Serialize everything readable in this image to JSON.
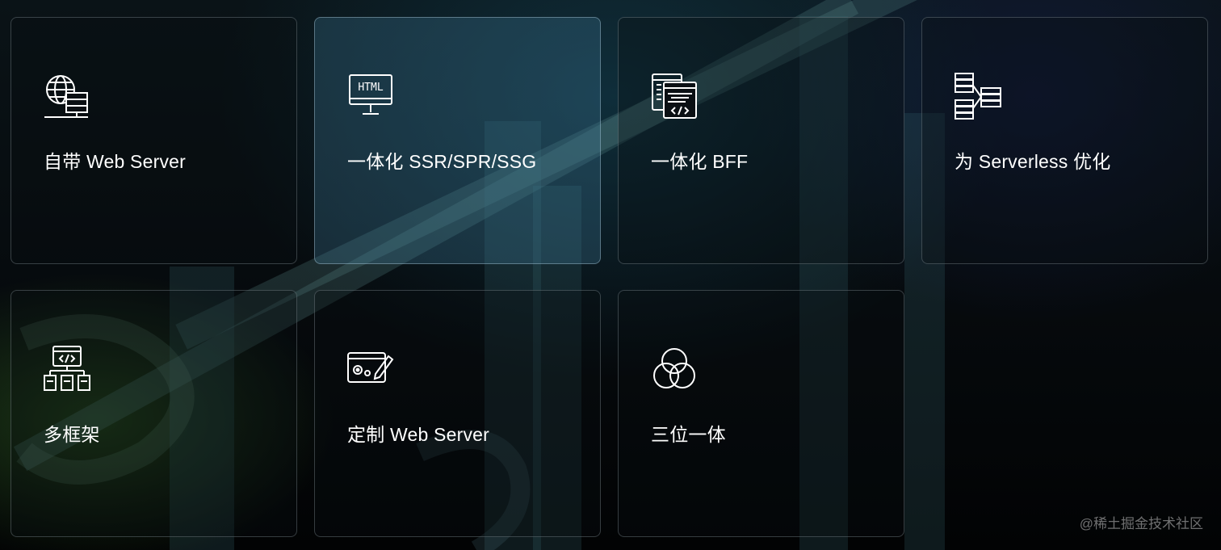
{
  "features": [
    {
      "label": "自带 Web Server",
      "icon": "globe-server-icon"
    },
    {
      "label": "一体化 SSR/SPR/SSG",
      "icon": "html-monitor-icon"
    },
    {
      "label": "一体化 BFF",
      "icon": "code-windows-icon"
    },
    {
      "label": "为 Serverless 优化",
      "icon": "server-network-icon"
    },
    {
      "label": "多框架",
      "icon": "framework-tree-icon"
    },
    {
      "label": "定制 Web Server",
      "icon": "settings-edit-window-icon"
    },
    {
      "label": "三位一体",
      "icon": "three-circles-icon"
    }
  ],
  "watermark": "@稀土掘金技术社区",
  "colors": {
    "text": "#ffffff",
    "active_card": "#3b6f86",
    "border": "#8f99a3"
  }
}
